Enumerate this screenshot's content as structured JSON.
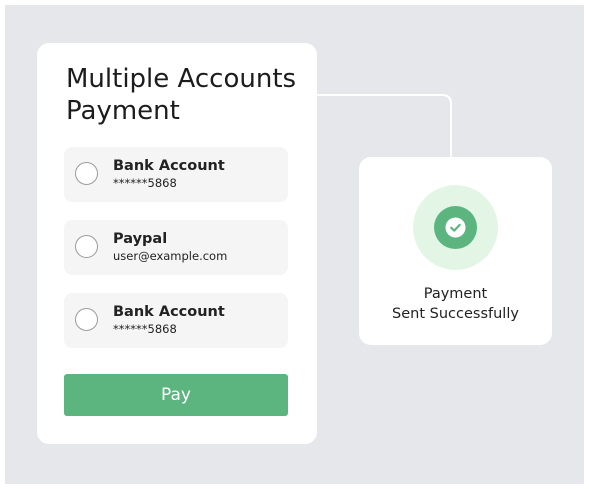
{
  "payment_card": {
    "title": "Multiple Accounts Payment",
    "accounts": [
      {
        "name": "Bank Account",
        "detail": "******5868"
      },
      {
        "name": "Paypal",
        "detail": "user@example.com"
      },
      {
        "name": "Bank Account",
        "detail": "******5868"
      }
    ],
    "pay_label": "Pay"
  },
  "success_card": {
    "line1": "Payment",
    "line2": "Sent Successfully",
    "icon": "check-circle-icon"
  },
  "colors": {
    "background": "#e6e7ea",
    "card": "#ffffff",
    "accent_green": "#5cb57f",
    "success_ring": "#e3f6e6",
    "account_row": "#f5f5f6"
  }
}
